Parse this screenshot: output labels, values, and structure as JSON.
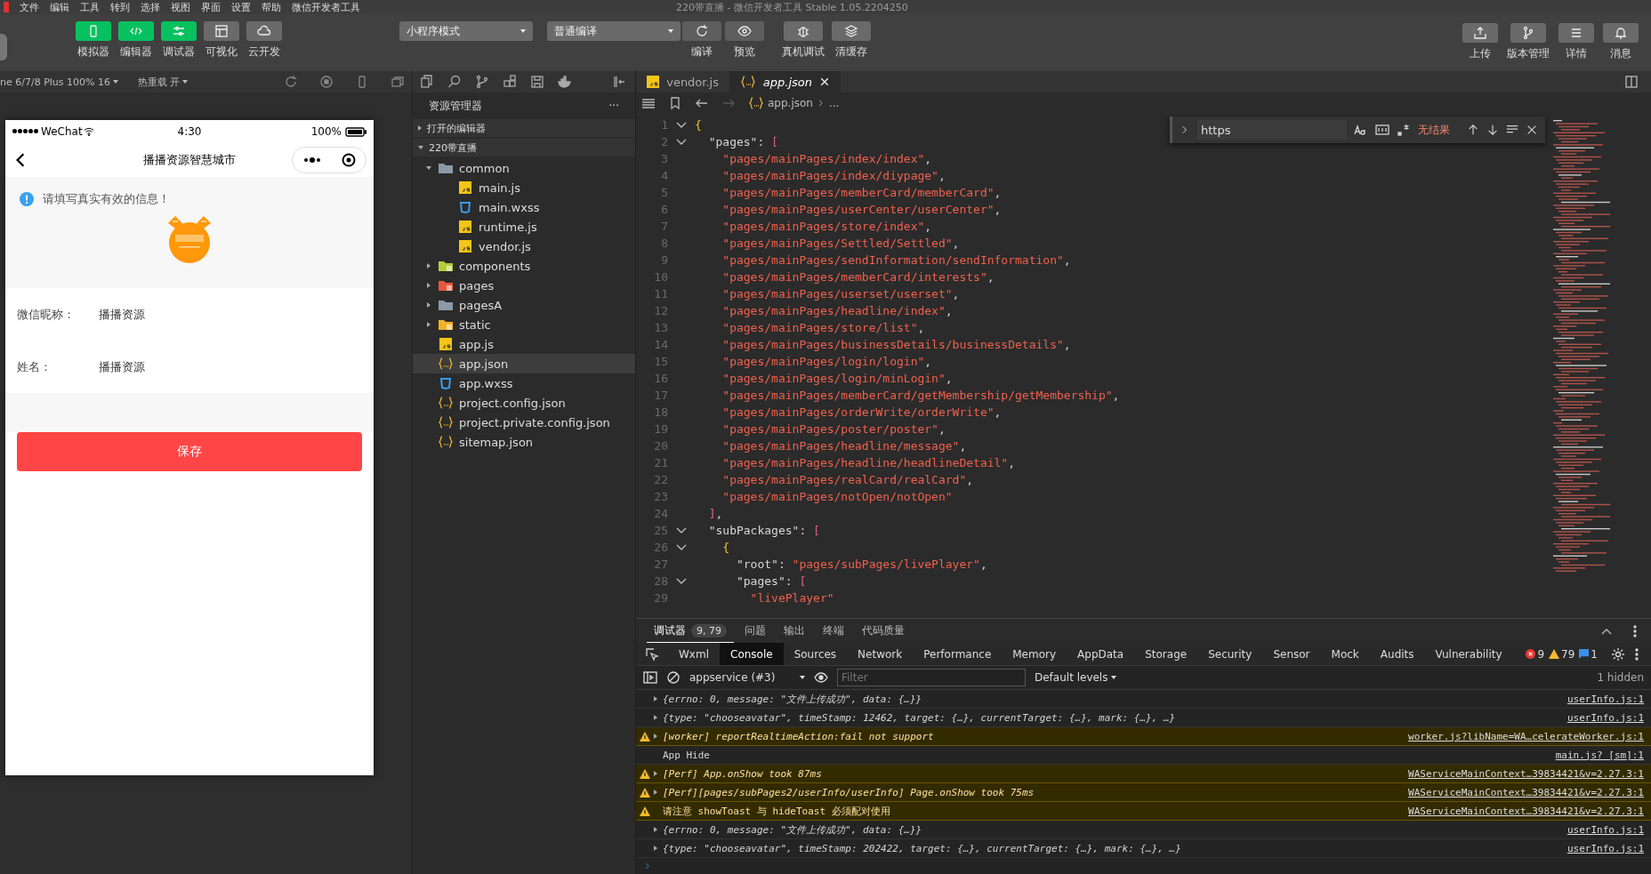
{
  "menu_bar": {
    "items": [
      "文件",
      "编辑",
      "工具",
      "转到",
      "选择",
      "视图",
      "界面",
      "设置",
      "帮助",
      "微信开发者工具"
    ],
    "title": "220带直播 - 微信开发者工具 Stable 1.05.2204250"
  },
  "toolbar": {
    "view_buttons": [
      {
        "label": "模拟器",
        "on": true
      },
      {
        "label": "编辑器",
        "on": true
      },
      {
        "label": "调试器",
        "on": true
      },
      {
        "label": "可视化",
        "on": false
      },
      {
        "label": "云开发",
        "on": false
      }
    ],
    "mode_select": "小程序模式",
    "compile_select": "普通编译",
    "actions": [
      {
        "label": "编译"
      },
      {
        "label": "预览"
      },
      {
        "label": "真机调试"
      },
      {
        "label": "清缓存"
      }
    ],
    "right_actions": [
      {
        "label": "上传"
      },
      {
        "label": "版本管理"
      },
      {
        "label": "详情"
      },
      {
        "label": "消息"
      }
    ]
  },
  "simulator": {
    "device_select": "ne 6/7/8 Plus 100% 16",
    "hot_reload": "热重载 开",
    "phone": {
      "carrier": "WeChat",
      "time": "4:30",
      "battery": "100%",
      "title": "播播资源智慧城市",
      "notice": "请填写真实有效的信息！",
      "fields": [
        {
          "label": "微信昵称：",
          "value": "播播资源"
        },
        {
          "label": "姓名：",
          "value": "播播资源"
        }
      ],
      "save_button": "保存"
    }
  },
  "explorer": {
    "title": "资源管理器",
    "more": "···",
    "sections": [
      {
        "label": "打开的编辑器",
        "expanded": false
      },
      {
        "label": "220带直播",
        "expanded": true
      }
    ],
    "tree": [
      {
        "name": "common",
        "kind": "folder",
        "expanded": true,
        "selected": false,
        "children": [
          {
            "name": "main.js",
            "kind": "js",
            "selected": false
          },
          {
            "name": "main.wxss",
            "kind": "wxss",
            "selected": false
          },
          {
            "name": "runtime.js",
            "kind": "js",
            "selected": false
          },
          {
            "name": "vendor.js",
            "kind": "js",
            "selected": false
          }
        ]
      },
      {
        "name": "components",
        "kind": "folder-components",
        "expanded": false,
        "selected": false
      },
      {
        "name": "pages",
        "kind": "folder-pages",
        "expanded": false,
        "selected": false
      },
      {
        "name": "pagesA",
        "kind": "folder",
        "expanded": false,
        "selected": false
      },
      {
        "name": "static",
        "kind": "folder-static",
        "expanded": false,
        "selected": false
      },
      {
        "name": "app.js",
        "kind": "js",
        "selected": false
      },
      {
        "name": "app.json",
        "kind": "json",
        "selected": true
      },
      {
        "name": "app.wxss",
        "kind": "wxss",
        "selected": false
      },
      {
        "name": "project.config.json",
        "kind": "json",
        "selected": false
      },
      {
        "name": "project.private.config.json",
        "kind": "json",
        "selected": false
      },
      {
        "name": "sitemap.json",
        "kind": "json",
        "selected": false
      }
    ]
  },
  "editor": {
    "tabs": [
      {
        "label": "vendor.js",
        "kind": "js",
        "selected": false
      },
      {
        "label": "app.json",
        "kind": "json",
        "selected": true
      }
    ],
    "breadcrumb": {
      "file": "app.json",
      "rest": "..."
    },
    "find": {
      "value": "https",
      "result": "无结果"
    },
    "lines": [
      {
        "number": "1",
        "fold": true,
        "tokens": [
          {
            "kind": "brace",
            "text": "{"
          }
        ]
      },
      {
        "number": "2",
        "fold": true,
        "tokens": [
          {
            "kind": "key",
            "text": "  \"pages\": "
          },
          {
            "kind": "bracket",
            "text": "["
          }
        ]
      },
      {
        "number": "3",
        "fold": false,
        "tokens": [
          {
            "kind": "string",
            "text": "    \"pages/mainPages/index/index\""
          },
          {
            "kind": "punct",
            "text": ","
          }
        ]
      },
      {
        "number": "4",
        "fold": false,
        "tokens": [
          {
            "kind": "string",
            "text": "    \"pages/mainPages/index/diypage\""
          },
          {
            "kind": "punct",
            "text": ","
          }
        ]
      },
      {
        "number": "5",
        "fold": false,
        "tokens": [
          {
            "kind": "string",
            "text": "    \"pages/mainPages/memberCard/memberCard\""
          },
          {
            "kind": "punct",
            "text": ","
          }
        ]
      },
      {
        "number": "6",
        "fold": false,
        "tokens": [
          {
            "kind": "string",
            "text": "    \"pages/mainPages/userCenter/userCenter\""
          },
          {
            "kind": "punct",
            "text": ","
          }
        ]
      },
      {
        "number": "7",
        "fold": false,
        "tokens": [
          {
            "kind": "string",
            "text": "    \"pages/mainPages/store/index\""
          },
          {
            "kind": "punct",
            "text": ","
          }
        ]
      },
      {
        "number": "8",
        "fold": false,
        "tokens": [
          {
            "kind": "string",
            "text": "    \"pages/mainPages/Settled/Settled\""
          },
          {
            "kind": "punct",
            "text": ","
          }
        ]
      },
      {
        "number": "9",
        "fold": false,
        "tokens": [
          {
            "kind": "string",
            "text": "    \"pages/mainPages/sendInformation/sendInformation\""
          },
          {
            "kind": "punct",
            "text": ","
          }
        ]
      },
      {
        "number": "10",
        "fold": false,
        "tokens": [
          {
            "kind": "string",
            "text": "    \"pages/mainPages/memberCard/interests\""
          },
          {
            "kind": "punct",
            "text": ","
          }
        ]
      },
      {
        "number": "11",
        "fold": false,
        "tokens": [
          {
            "kind": "string",
            "text": "    \"pages/mainPages/userset/userset\""
          },
          {
            "kind": "punct",
            "text": ","
          }
        ]
      },
      {
        "number": "12",
        "fold": false,
        "tokens": [
          {
            "kind": "string",
            "text": "    \"pages/mainPages/headline/index\""
          },
          {
            "kind": "punct",
            "text": ","
          }
        ]
      },
      {
        "number": "13",
        "fold": false,
        "tokens": [
          {
            "kind": "string",
            "text": "    \"pages/mainPages/store/list\""
          },
          {
            "kind": "punct",
            "text": ","
          }
        ]
      },
      {
        "number": "14",
        "fold": false,
        "tokens": [
          {
            "kind": "string",
            "text": "    \"pages/mainPages/businessDetails/businessDetails\""
          },
          {
            "kind": "punct",
            "text": ","
          }
        ]
      },
      {
        "number": "15",
        "fold": false,
        "tokens": [
          {
            "kind": "string",
            "text": "    \"pages/mainPages/login/login\""
          },
          {
            "kind": "punct",
            "text": ","
          }
        ]
      },
      {
        "number": "16",
        "fold": false,
        "tokens": [
          {
            "kind": "string",
            "text": "    \"pages/mainPages/login/minLogin\""
          },
          {
            "kind": "punct",
            "text": ","
          }
        ]
      },
      {
        "number": "17",
        "fold": false,
        "tokens": [
          {
            "kind": "string",
            "text": "    \"pages/mainPages/memberCard/getMembership/getMembership\""
          },
          {
            "kind": "punct",
            "text": ","
          }
        ]
      },
      {
        "number": "18",
        "fold": false,
        "tokens": [
          {
            "kind": "string",
            "text": "    \"pages/mainPages/orderWrite/orderWrite\""
          },
          {
            "kind": "punct",
            "text": ","
          }
        ]
      },
      {
        "number": "19",
        "fold": false,
        "tokens": [
          {
            "kind": "string",
            "text": "    \"pages/mainPages/poster/poster\""
          },
          {
            "kind": "punct",
            "text": ","
          }
        ]
      },
      {
        "number": "20",
        "fold": false,
        "tokens": [
          {
            "kind": "string",
            "text": "    \"pages/mainPages/headline/message\""
          },
          {
            "kind": "punct",
            "text": ","
          }
        ]
      },
      {
        "number": "21",
        "fold": false,
        "tokens": [
          {
            "kind": "string",
            "text": "    \"pages/mainPages/headline/headlineDetail\""
          },
          {
            "kind": "punct",
            "text": ","
          }
        ]
      },
      {
        "number": "22",
        "fold": false,
        "tokens": [
          {
            "kind": "string",
            "text": "    \"pages/mainPages/realCard/realCard\""
          },
          {
            "kind": "punct",
            "text": ","
          }
        ]
      },
      {
        "number": "23",
        "fold": false,
        "tokens": [
          {
            "kind": "string",
            "text": "    \"pages/mainPages/notOpen/notOpen\""
          }
        ]
      },
      {
        "number": "24",
        "fold": false,
        "tokens": [
          {
            "kind": "bracket",
            "text": "  ]"
          },
          {
            "kind": "punct",
            "text": ","
          }
        ]
      },
      {
        "number": "25",
        "fold": true,
        "tokens": [
          {
            "kind": "key",
            "text": "  \"subPackages\": "
          },
          {
            "kind": "bracket",
            "text": "["
          }
        ]
      },
      {
        "number": "26",
        "fold": true,
        "tokens": [
          {
            "kind": "brace",
            "text": "    {"
          }
        ]
      },
      {
        "number": "27",
        "fold": false,
        "tokens": [
          {
            "kind": "key",
            "text": "      \"root\": "
          },
          {
            "kind": "string",
            "text": "\"pages/subPages/livePlayer\""
          },
          {
            "kind": "punct",
            "text": ","
          }
        ]
      },
      {
        "number": "28",
        "fold": true,
        "tokens": [
          {
            "kind": "key",
            "text": "      \"pages\": "
          },
          {
            "kind": "bracket",
            "text": "["
          }
        ]
      },
      {
        "number": "29",
        "fold": false,
        "tokens": [
          {
            "kind": "string",
            "text": "        \"livePlayer\""
          }
        ]
      }
    ]
  },
  "debug": {
    "tabs": [
      {
        "label": "调试器",
        "badge": "9, 79",
        "selected": true
      },
      {
        "label": "问题",
        "selected": false
      },
      {
        "label": "输出",
        "selected": false
      },
      {
        "label": "终端",
        "selected": false
      },
      {
        "label": "代码质量",
        "selected": false
      }
    ],
    "devtools_tabs": [
      {
        "label": "Wxml",
        "selected": false
      },
      {
        "label": "Console",
        "selected": true
      },
      {
        "label": "Sources",
        "selected": false
      },
      {
        "label": "Network",
        "selected": false
      },
      {
        "label": "Performance",
        "selected": false
      },
      {
        "label": "Memory",
        "selected": false
      },
      {
        "label": "AppData",
        "selected": false
      },
      {
        "label": "Storage",
        "selected": false
      },
      {
        "label": "Security",
        "selected": false
      },
      {
        "label": "Sensor",
        "selected": false
      },
      {
        "label": "Mock",
        "selected": false
      },
      {
        "label": "Audits",
        "selected": false
      },
      {
        "label": "Vulnerability",
        "selected": false
      }
    ],
    "counts": {
      "errors": "9",
      "warnings": "79",
      "info": "1"
    },
    "context_select": "appservice (#3)",
    "filter": {
      "placeholder": "Filter"
    },
    "levels_select": "Default levels",
    "hidden": "1 hidden",
    "rows": [
      {
        "kind": "object",
        "warning": false,
        "text": "{errno: 0, message: \"文件上传成功\", data: {…}}",
        "source": "userInfo.js:1"
      },
      {
        "kind": "object",
        "warning": false,
        "text": "{type: \"chooseavatar\", timeStamp: 12462, target: {…}, currentTarget: {…}, mark: {…}, …}",
        "source": "userInfo.js:1"
      },
      {
        "kind": "object",
        "warning": true,
        "text": "[worker] reportRealtimeAction:fail not support",
        "source": "worker.js?libName=WA…celerateWorker.js:1"
      },
      {
        "kind": "plain",
        "warning": false,
        "text": "App Hide",
        "source": "main.js? [sm]:1"
      },
      {
        "kind": "object",
        "warning": true,
        "text": "[Perf] App.onShow took 87ms",
        "source": "WAServiceMainContext…39834421&v=2.27.3:1"
      },
      {
        "kind": "object",
        "warning": true,
        "text": "[Perf][pages/subPages2/userInfo/userInfo] Page.onShow took 75ms",
        "source": "WAServiceMainContext…39834421&v=2.27.3:1"
      },
      {
        "kind": "plain",
        "warning": true,
        "text": "请注意 showToast 与 hideToast 必须配对使用",
        "source": "WAServiceMainContext…39834421&v=2.27.3:1"
      },
      {
        "kind": "object",
        "warning": false,
        "text": "{errno: 0, message: \"文件上传成功\", data: {…}}",
        "source": "userInfo.js:1"
      },
      {
        "kind": "object",
        "warning": false,
        "text": "{type: \"chooseavatar\", timeStamp: 202422, target: {…}, currentTarget: {…}, mark: {…}, …}",
        "source": "userInfo.js:1"
      }
    ]
  }
}
